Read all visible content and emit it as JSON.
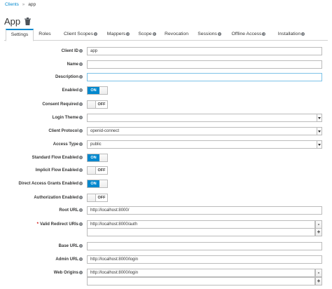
{
  "breadcrumb": {
    "parent": "Clients",
    "separator": "»",
    "current": "app"
  },
  "page": {
    "title": "App"
  },
  "tabs": [
    {
      "label": "Settings",
      "help": false
    },
    {
      "label": "Roles",
      "help": false
    },
    {
      "label": "Client Scopes",
      "help": true
    },
    {
      "label": "Mappers",
      "help": true
    },
    {
      "label": "Scope",
      "help": true
    },
    {
      "label": "Revocation",
      "help": false
    },
    {
      "label": "Sessions",
      "help": true
    },
    {
      "label": "Offline Access",
      "help": true
    },
    {
      "label": "Installation",
      "help": true
    }
  ],
  "form": {
    "client_id": {
      "label": "Client ID",
      "value": "app"
    },
    "name": {
      "label": "Name",
      "value": ""
    },
    "description": {
      "label": "Description",
      "value": ""
    },
    "enabled": {
      "label": "Enabled",
      "state": "ON"
    },
    "consent_required": {
      "label": "Consent Required",
      "state": "OFF"
    },
    "login_theme": {
      "label": "Login Theme",
      "value": ""
    },
    "client_protocol": {
      "label": "Client Protocol",
      "value": "openid-connect"
    },
    "access_type": {
      "label": "Access Type",
      "value": "public"
    },
    "standard_flow": {
      "label": "Standard Flow Enabled",
      "state": "ON"
    },
    "implicit_flow": {
      "label": "Implicit Flow Enabled",
      "state": "OFF"
    },
    "direct_access": {
      "label": "Direct Access Grants Enabled",
      "state": "ON"
    },
    "authorization": {
      "label": "Authorization Enabled",
      "state": "OFF"
    },
    "root_url": {
      "label": "Root URL",
      "value": "http://localhost:8000/"
    },
    "redirect_uris": {
      "label": "Valid Redirect URIs",
      "required": "*",
      "value": "http://localhost:8000/auth",
      "new_value": "",
      "remove_label": "-",
      "add_label": "+"
    },
    "base_url": {
      "label": "Base URL",
      "value": ""
    },
    "admin_url": {
      "label": "Admin URL",
      "value": "http://localhost:8000/login"
    },
    "web_origins": {
      "label": "Web Origins",
      "value": "http://localhost:8000/login",
      "new_value": "",
      "remove_label": "-",
      "add_label": "+"
    }
  },
  "colors": {
    "accent": "#0088ce",
    "text": "#363636",
    "border": "#bbbbbb"
  }
}
